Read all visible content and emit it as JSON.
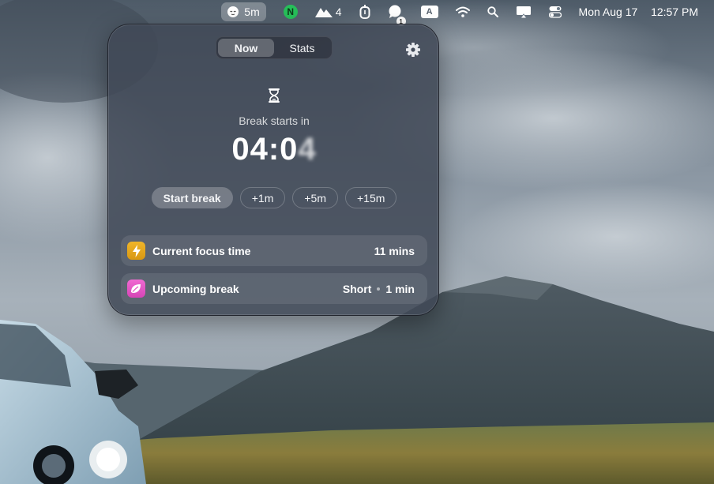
{
  "menubar": {
    "break_timer": "5m",
    "n_app_letter": "N",
    "mountain_count": "4",
    "chat_badge": "1",
    "input_source": "A",
    "date": "Mon Aug 17",
    "time": "12:57 PM"
  },
  "popover": {
    "tabs": [
      {
        "label": "Now",
        "active": true
      },
      {
        "label": "Stats",
        "active": false
      }
    ],
    "subtitle": "Break starts in",
    "countdown_main": "04:0",
    "countdown_last": "4",
    "actions": {
      "start": "Start break",
      "plus1": "+1m",
      "plus5": "+5m",
      "plus15": "+15m"
    },
    "focus_row": {
      "label": "Current focus time",
      "value": "11 mins",
      "icon": "lightning-icon",
      "color": "#e3a51b"
    },
    "break_row": {
      "label": "Upcoming break",
      "type": "Short",
      "duration": "1 min",
      "icon": "leaf-icon",
      "color": "#e655c4"
    }
  }
}
